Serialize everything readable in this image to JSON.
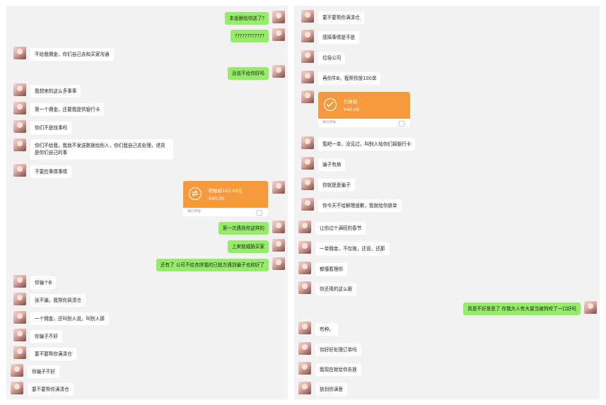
{
  "left_chat": {
    "messages": [
      {
        "side": "r",
        "text": "本金删给你送了?"
      },
      {
        "side": "r",
        "text": "????????????"
      },
      {
        "side": "l",
        "text": "不给我佣金，你们自己去和买家沟通"
      },
      {
        "side": "r",
        "text": "没说不给你好吗"
      },
      {
        "side": "l",
        "text": "我想来的这么多事事"
      },
      {
        "side": "l",
        "text": "第一个佣金，还要我提供银行卡"
      },
      {
        "side": "l",
        "text": "你们不是找事吗"
      },
      {
        "side": "l",
        "text": "你们不给我，我就不发送数据给别人，你们我自己去处理，退货是你们自己的事"
      },
      {
        "side": "l",
        "text": "不要应事情事情"
      },
      {
        "side": "r",
        "text": "第一次遇到你这样的"
      },
      {
        "side": "r",
        "text": "上来就威胁买家"
      },
      {
        "side": "r",
        "text": "还有了 公司不给赤拼我的已就方遇到骗子也抑好了"
      },
      {
        "side": "l",
        "text": "你骗个B"
      },
      {
        "side": "l",
        "text": "张不骗，我帮你搞清仓"
      },
      {
        "side": "l",
        "text": "一个佣金，还叫别人说，叫别人那"
      },
      {
        "side": "l",
        "text": "你骗子不好"
      },
      {
        "side": "l",
        "text": "要不要帮你满清仓"
      },
      {
        "side": "l",
        "text": "你骗子不好"
      },
      {
        "side": "l",
        "text": "要不要帮你满清仓"
      }
    ],
    "transfer": {
      "title": "转账给103.00元",
      "amount": "¥40.00",
      "footer": "微信转账"
    }
  },
  "right_chat": {
    "messages": [
      {
        "side": "l",
        "text": "要不要帮你满清仓"
      },
      {
        "side": "l",
        "text": "感搞事情是不是"
      },
      {
        "side": "l",
        "text": "垃圾公司"
      },
      {
        "side": "l",
        "text": "再你牛B，我帮你放100单"
      },
      {
        "side": "l",
        "text": "冤吧一单，没见过，叫别人给你们搞银行卡"
      },
      {
        "side": "l",
        "text": "骗子有病"
      },
      {
        "side": "l",
        "text": "你就是是骗子"
      },
      {
        "side": "l",
        "text": "你今天不给解理道歉，我就给你放单"
      },
      {
        "side": "l",
        "text": "让你过个满旺的春节"
      },
      {
        "side": "l",
        "text": "一单佣金，不仅拖，还说，还那"
      },
      {
        "side": "l",
        "text": "都懂着理你"
      },
      {
        "side": "l",
        "text": "你还用的这么跟"
      },
      {
        "side": "r",
        "text": "真是不好意思了 你我大人有大量当被狗咬了一口好吗"
      },
      {
        "side": "l",
        "text": "有种。"
      },
      {
        "side": "l",
        "text": "你好好处理订单吗"
      },
      {
        "side": "l",
        "text": "我现在就给你去放"
      },
      {
        "side": "l",
        "text": "放到你满意"
      }
    ],
    "transfer": {
      "title": "已收钱",
      "amount": "¥40.00",
      "footer": "微信转账"
    }
  },
  "colors": {
    "sent_bubble": "#95ec69",
    "received_bubble": "#ffffff",
    "transfer": "#f79a3e",
    "panel_bg": "#f2f2f2"
  }
}
